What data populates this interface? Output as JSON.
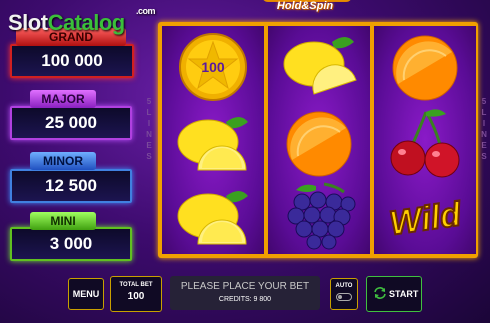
{
  "watermark": {
    "slot": "Slot",
    "catalog": "Catalog",
    "com": ".com"
  },
  "title": {
    "line1": "Hold&Spin"
  },
  "jackpots": {
    "grand": {
      "label": "GRAND",
      "value": "100 000"
    },
    "major": {
      "label": "MAJOR",
      "value": "25 000"
    },
    "minor": {
      "label": "MINOR",
      "value": "12 500"
    },
    "mini": {
      "label": "MINI",
      "value": "3 000"
    }
  },
  "side_lines": {
    "text": "5 LINES"
  },
  "reels": [
    [
      "coin",
      "lemon",
      "lemon"
    ],
    [
      "lemon",
      "orange",
      "grapes"
    ],
    [
      "orange",
      "cherry",
      "wild"
    ]
  ],
  "coin_value": "100",
  "wild_text": "Wild",
  "controls": {
    "menu": "MENU",
    "total_bet_label": "TOTAL BET",
    "total_bet_value": "100",
    "message": "PLEASE PLACE YOUR BET",
    "credits": "CREDITS: 9 800",
    "auto": "AUTO",
    "start": "START"
  }
}
